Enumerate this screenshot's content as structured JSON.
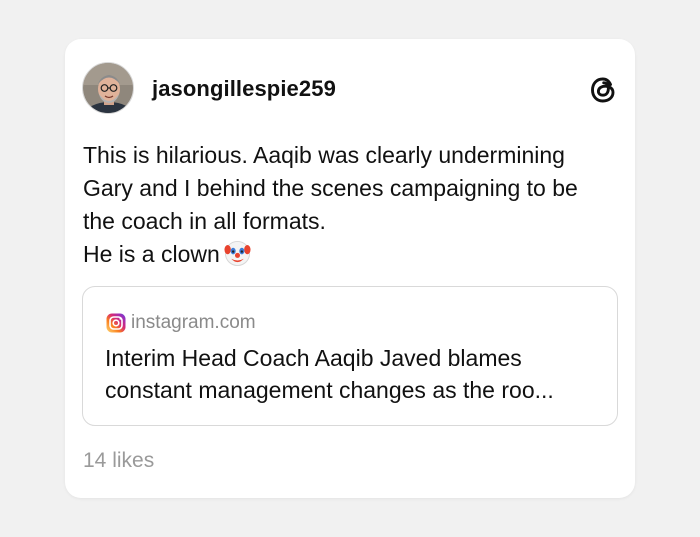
{
  "post": {
    "username": "jasongillespie259",
    "text_lines": [
      "This is hilarious. Aaqib was clearly undermining",
      "Gary and I behind the scenes campaigning to be",
      "the coach in all formats.",
      "He is a clown"
    ],
    "emoji": "clown-face",
    "likes": "14 likes"
  },
  "link_preview": {
    "domain": "instagram.com",
    "title_lines": [
      "Interim Head Coach Aaqib Javed blames",
      "constant management changes as the roo..."
    ]
  },
  "icons": {
    "brand": "threads-logo-icon",
    "source": "instagram-icon"
  },
  "colors": {
    "background": "#f1f1f1",
    "card": "#ffffff",
    "text": "#111111",
    "muted": "#8a8a8a"
  }
}
